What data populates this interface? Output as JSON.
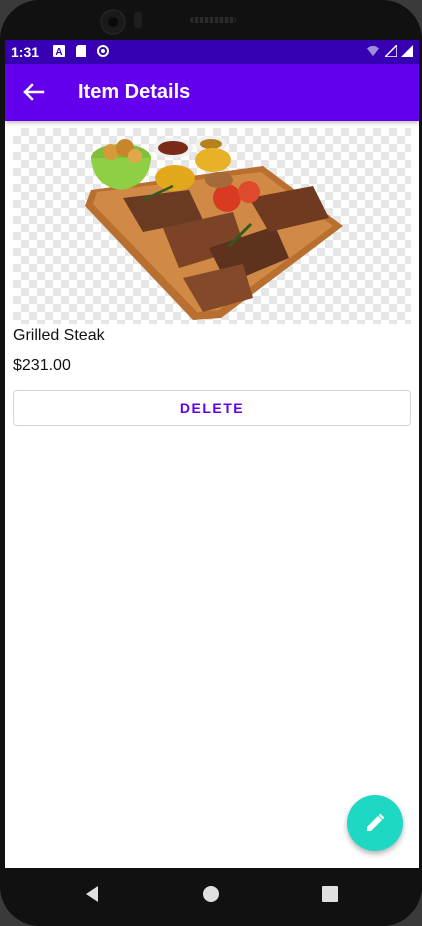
{
  "status_bar": {
    "time": "1:31",
    "icons": [
      "notification-a-icon",
      "sd-card-icon",
      "sync-icon",
      "wifi-icon",
      "signal-icon",
      "battery-icon"
    ]
  },
  "app_bar": {
    "title": "Item Details",
    "back_icon": "arrow-back-icon",
    "color": "#6200ee"
  },
  "item": {
    "image_icon": "grilled-steak-image",
    "name": "Grilled Steak",
    "price": "$231.00"
  },
  "actions": {
    "delete_label": "DELETE",
    "fab_icon": "edit-pencil-icon",
    "fab_color": "#1fd8c3"
  },
  "nav_bar": {
    "back": "nav-back-icon",
    "home": "nav-home-icon",
    "recents": "nav-recents-icon"
  }
}
